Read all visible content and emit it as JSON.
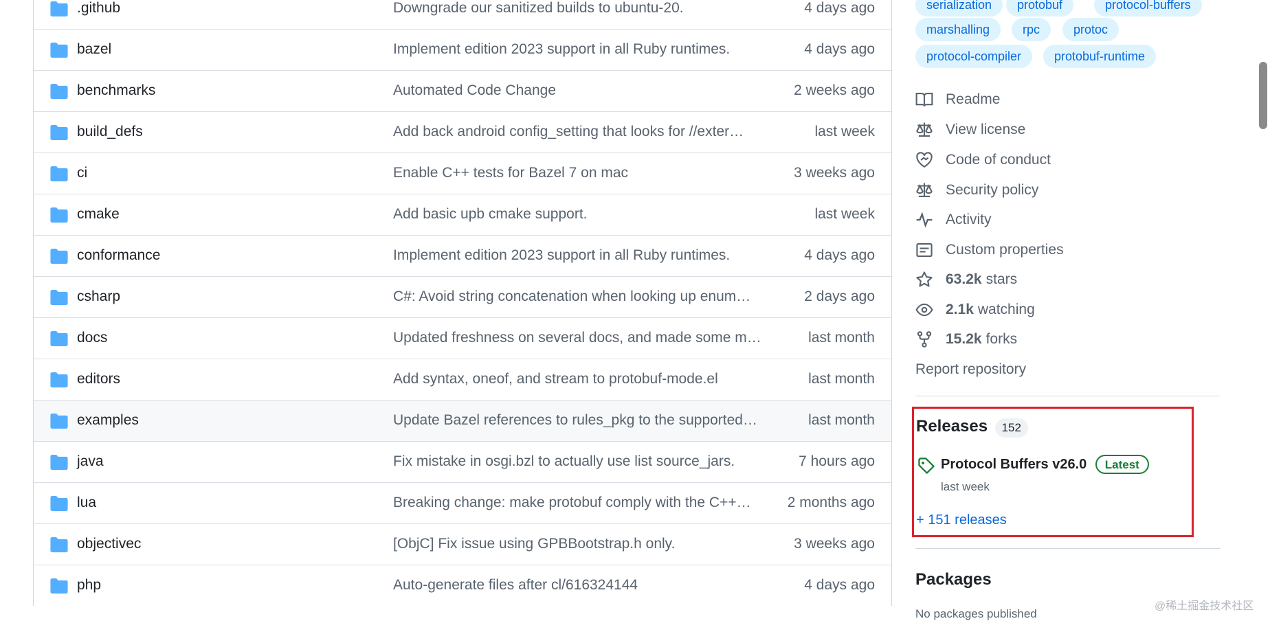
{
  "files": [
    {
      "name": ".github",
      "message": "Downgrade our sanitized builds to ubuntu-20.",
      "age": "4 days ago"
    },
    {
      "name": "bazel",
      "message": "Implement edition 2023 support in all Ruby runtimes.",
      "age": "4 days ago"
    },
    {
      "name": "benchmarks",
      "message": "Automated Code Change",
      "age": "2 weeks ago"
    },
    {
      "name": "build_defs",
      "message": "Add back android config_setting that looks for //exter…",
      "age": "last week"
    },
    {
      "name": "ci",
      "message": "Enable C++ tests for Bazel 7 on mac",
      "age": "3 weeks ago"
    },
    {
      "name": "cmake",
      "message": "Add basic upb cmake support.",
      "age": "last week"
    },
    {
      "name": "conformance",
      "message": "Implement edition 2023 support in all Ruby runtimes.",
      "age": "4 days ago"
    },
    {
      "name": "csharp",
      "message": "C#: Avoid string concatenation when looking up enum…",
      "age": "2 days ago"
    },
    {
      "name": "docs",
      "message": "Updated freshness on several docs, and made some m…",
      "age": "last month"
    },
    {
      "name": "editors",
      "message": "Add syntax, oneof, and stream to protobuf-mode.el",
      "age": "last month"
    },
    {
      "name": "examples",
      "message": "Update Bazel references to rules_pkg to the supported…",
      "age": "last month"
    },
    {
      "name": "java",
      "message": "Fix mistake in osgi.bzl to actually use list source_jars.",
      "age": "7 hours ago"
    },
    {
      "name": "lua",
      "message": "Breaking change: make protobuf comply with the C++…",
      "age": "2 months ago"
    },
    {
      "name": "objectivec",
      "message": "[ObjC] Fix issue using GPBBootstrap.h only.",
      "age": "3 weeks ago"
    },
    {
      "name": "php",
      "message": "Auto-generate files after cl/616324144",
      "age": "4 days ago"
    }
  ],
  "hovered_row": "examples",
  "topics": [
    "serialization",
    "protobuf",
    "protocol-buffers",
    "marshalling",
    "rpc",
    "protoc",
    "protocol-compiler",
    "protobuf-runtime"
  ],
  "about": {
    "readme": "Readme",
    "license": "View license",
    "conduct": "Code of conduct",
    "security": "Security policy",
    "activity": "Activity",
    "custom_properties": "Custom properties",
    "stars_count": "63.2k",
    "stars_label": "stars",
    "watching_count": "2.1k",
    "watching_label": "watching",
    "forks_count": "15.2k",
    "forks_label": "forks",
    "report": "Report repository"
  },
  "releases": {
    "title": "Releases",
    "count": "152",
    "latest_name": "Protocol Buffers v26.0",
    "latest_badge": "Latest",
    "latest_date": "last week",
    "more_link": "+ 151 releases"
  },
  "packages": {
    "title": "Packages",
    "empty_text": "No packages published"
  },
  "watermark": "@稀土掘金技术社区",
  "colors": {
    "folder": "#54aeff",
    "link": "#0969da",
    "highlight_border": "#d9232d",
    "latest_green": "#1a7f37"
  }
}
